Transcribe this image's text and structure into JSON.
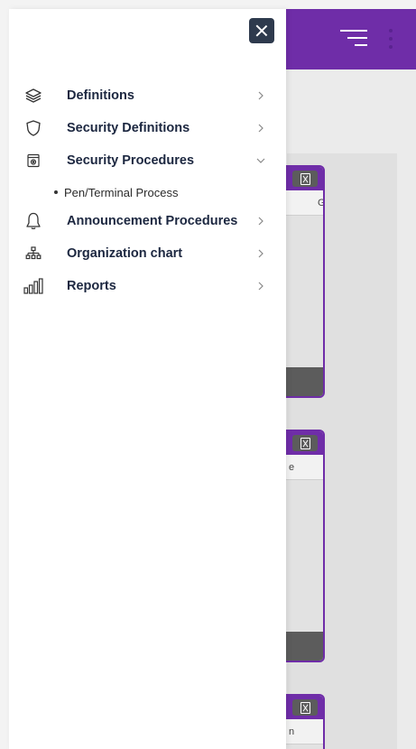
{
  "colors": {
    "brand_purple": "#6f2da8",
    "drawer_bg": "#ffffff",
    "menu_text": "#1c2740",
    "close_button_bg": "#2e3a4d",
    "card_footer": "#5c5c5c"
  },
  "drawer": {
    "close_icon": "close-icon",
    "menu": [
      {
        "label": "Definitions",
        "icon": "layers-icon",
        "expanded": false
      },
      {
        "label": "Security Definitions",
        "icon": "shield-icon",
        "expanded": false
      },
      {
        "label": "Security Procedures",
        "icon": "safe-icon",
        "expanded": true,
        "children": [
          {
            "label": "Pen/Terminal Process"
          }
        ]
      },
      {
        "label": "Announcement Procedures",
        "icon": "bell-icon",
        "expanded": false
      },
      {
        "label": "Organization chart",
        "icon": "org-chart-icon",
        "expanded": false
      },
      {
        "label": "Reports",
        "icon": "bar-chart-icon",
        "expanded": false
      }
    ]
  },
  "header": {
    "menu_icon": "hamburger-icon",
    "more_icon": "kebab-icon"
  },
  "cards": [
    {
      "subheader_text": "G",
      "export_icon": "excel-icon"
    },
    {
      "subheader_text": "e",
      "export_icon": "excel-icon"
    },
    {
      "subheader_text": "n",
      "export_icon": "excel-icon"
    }
  ]
}
